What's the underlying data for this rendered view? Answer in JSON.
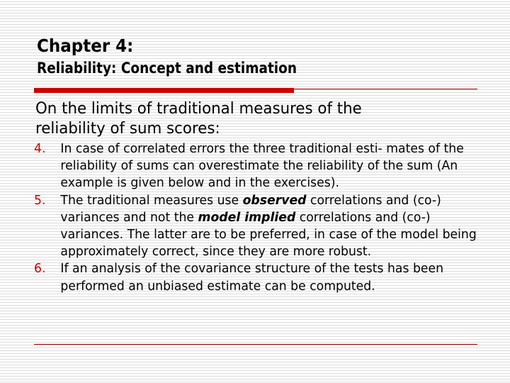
{
  "slide": {
    "title": "Chapter 4:",
    "subtitle": "Reliability: Concept and estimation",
    "accent_color": "#cc0000",
    "intro": "On the limits of traditional measures of the\nreliability of sum scores:",
    "items": [
      {
        "number": "4.",
        "text": "In case of correlated errors the three traditional esti- mates of the reliability of sums can overestimate the reliability of the sum (An example is given below and in the exercises)."
      },
      {
        "number": "5.",
        "parts": {
          "a": "The traditional measures use ",
          "b": "observed",
          "c": " correlations and (co-) variances and not the ",
          "d": "model implied",
          "e": " correlations and (co-) variances. The latter are to be preferred, in case of the model being approximately correct, since they are more robust."
        }
      },
      {
        "number": "6.",
        "text": "If an analysis of the covariance structure of the tests has been performed an unbiased estimate can be computed."
      }
    ]
  }
}
